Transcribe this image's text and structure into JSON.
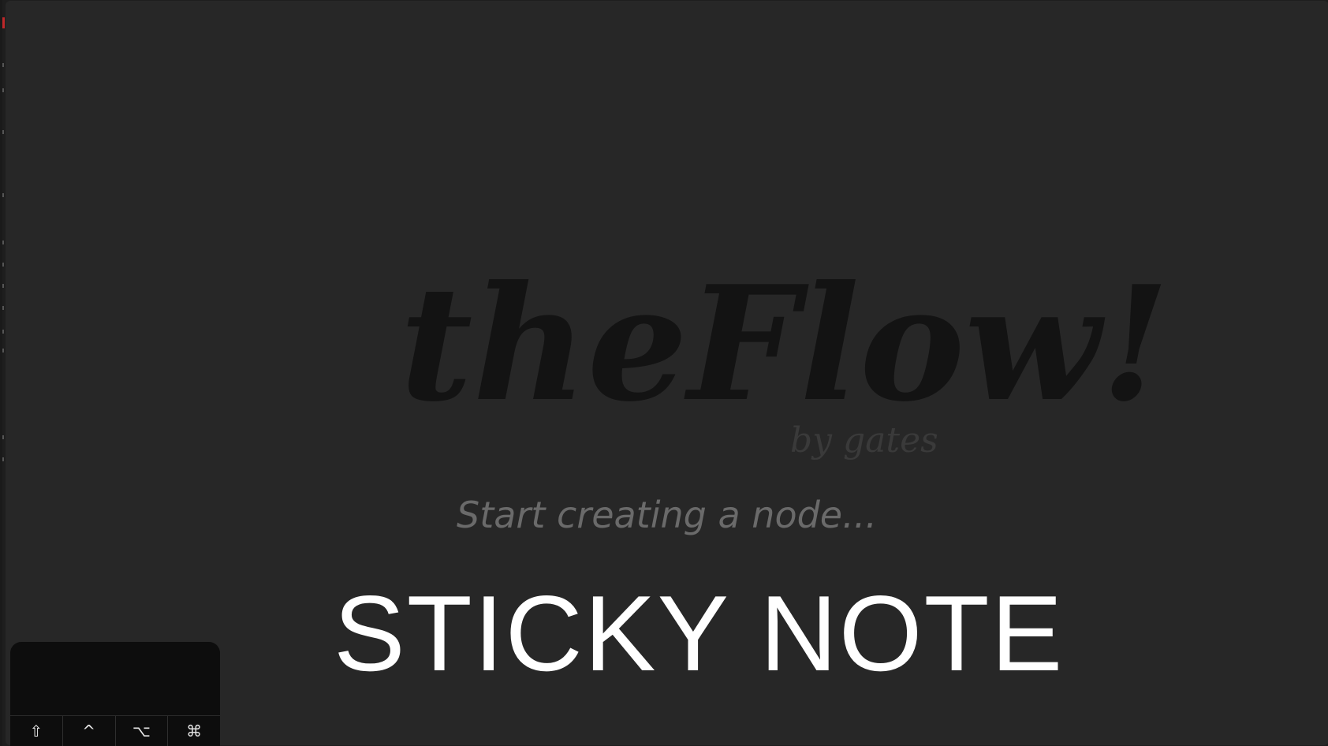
{
  "splash": {
    "logo_title": "theFlow!",
    "logo_byline": "by gates",
    "prompt": "Start creating a node..."
  },
  "sticky_note": {
    "title": "STICKY NOTE"
  },
  "modifier_keys": [
    {
      "symbol": "⇧",
      "icon": "shift-icon"
    },
    {
      "symbol": "^",
      "icon": "control-icon"
    },
    {
      "symbol": "⌥",
      "icon": "option-icon"
    },
    {
      "symbol": "⌘",
      "icon": "command-icon"
    }
  ],
  "colors": {
    "canvas_background": "#272727",
    "logo": "#131313",
    "byline": "#3a3a3a",
    "prompt": "#6a6a6a",
    "sticky_text": "#ffffff",
    "keypad_background": "#0d0d0d",
    "accent_red": "#c0282a"
  }
}
